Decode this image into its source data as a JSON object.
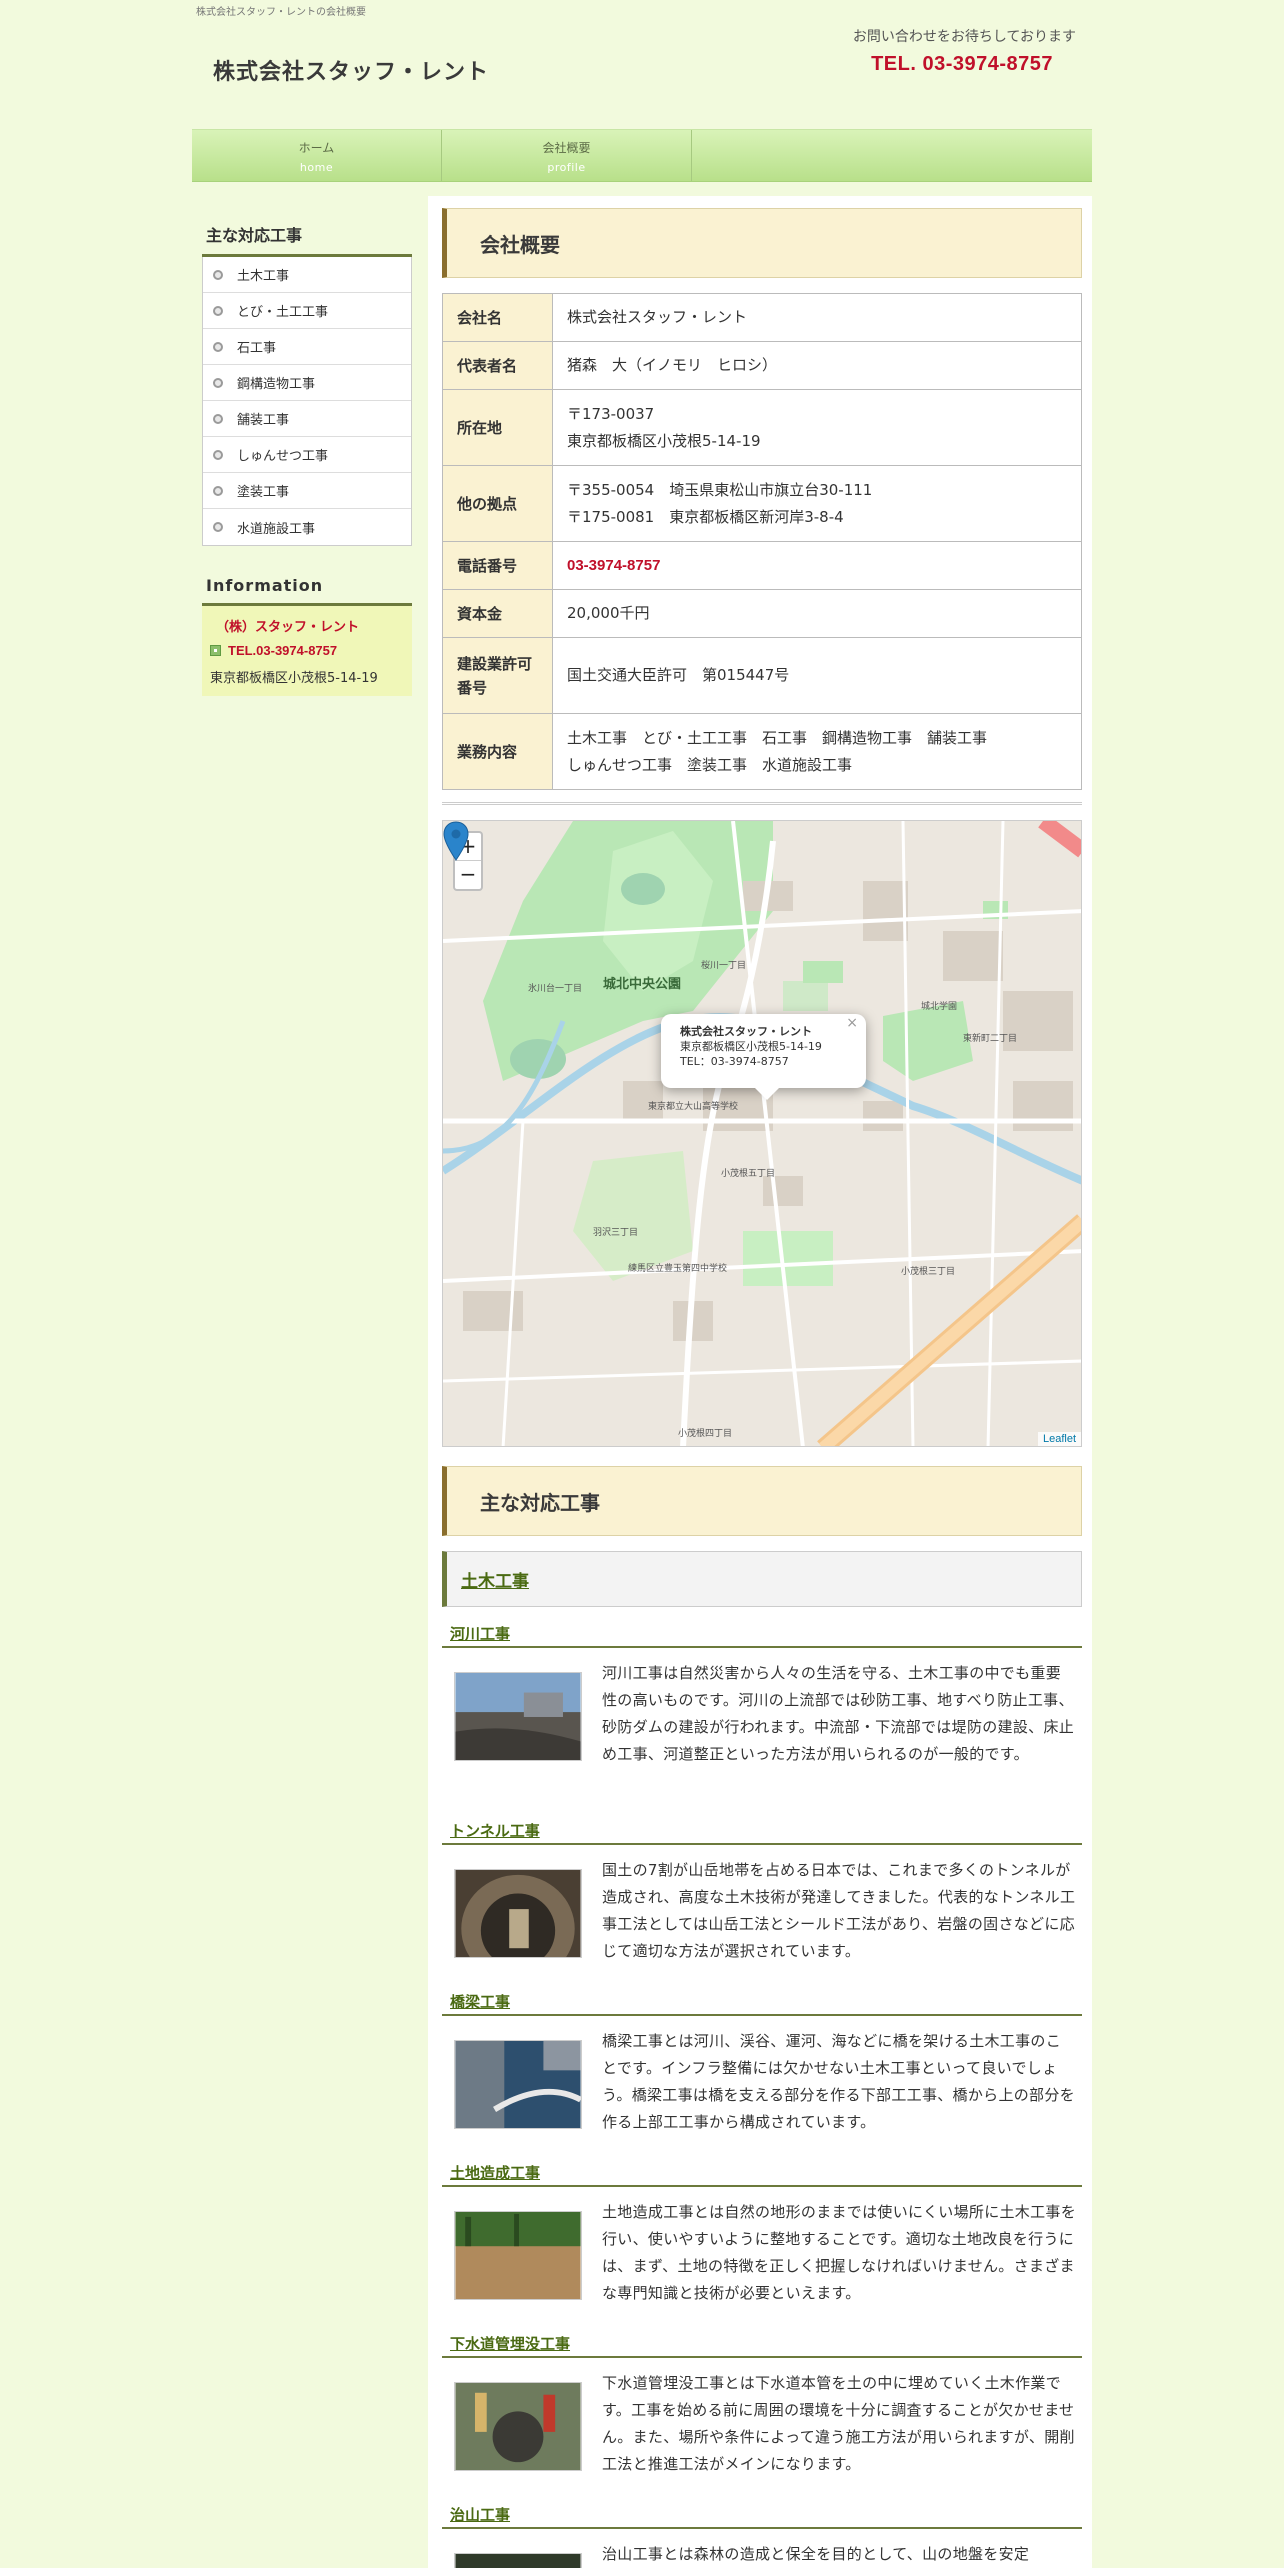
{
  "header": {
    "tagline": "株式会社スタッフ・レントの会社概要",
    "site_title": "株式会社スタッフ・レント",
    "contact_note": "お問い合わせをお待ちしております",
    "contact_tel": "TEL. 03-3974-8757"
  },
  "nav": [
    {
      "ja": "ホーム",
      "en": "home"
    },
    {
      "ja": "会社概要",
      "en": "profile"
    }
  ],
  "sidebar": {
    "heading": "主な対応工事",
    "items": [
      "土木工事",
      "とび・土工工事",
      "石工事",
      "鋼構造物工事",
      "舗装工事",
      "しゅんせつ工事",
      "塗装工事",
      "水道施設工事"
    ],
    "info_heading": "Information",
    "info_name": "（株）スタッフ・レント",
    "info_tel": "TEL.03-3974-8757",
    "info_address": "東京都板橋区小茂根5-14-19"
  },
  "main": {
    "profile_heading": "会社概要",
    "profile": [
      {
        "label": "会社名",
        "value": [
          "株式会社スタッフ・レント"
        ]
      },
      {
        "label": "代表者名",
        "value": [
          "猪森　大（イノモリ　ヒロシ）"
        ]
      },
      {
        "label": "所在地",
        "value": [
          "〒173-0037",
          "東京都板橋区小茂根5-14-19"
        ]
      },
      {
        "label": "他の拠点",
        "value": [
          "〒355-0054　埼玉県東松山市旗立台30-111",
          "〒175-0081　東京都板橋区新河岸3-8-4"
        ]
      },
      {
        "label": "電話番号",
        "value": [
          "03-3974-8757"
        ]
      },
      {
        "label": "資本金",
        "value": [
          "20,000千円"
        ]
      },
      {
        "label": "建設業許可番号",
        "value": [
          "国土交通大臣許可　第015447号"
        ]
      },
      {
        "label": "業務内容",
        "value": [
          "土木工事　とび・土工工事　石工事　鋼構造物工事　舗装工事",
          "しゅんせつ工事　塗装工事　水道施設工事"
        ]
      }
    ],
    "map": {
      "zoom_in": "+",
      "zoom_out": "−",
      "popup_title": "株式会社スタッフ・レント",
      "popup_address": "東京都板橋区小茂根5-14-19",
      "popup_tel": "TEL：03-3974-8757",
      "popup_close": "×",
      "attribution": "Leaflet",
      "labels": [
        "城北中央公園",
        "桜川一丁目",
        "氷川台一丁目",
        "小茂根五丁目",
        "羽沢三丁目",
        "小茂根三丁目",
        "小茂根四丁目",
        "東新町二丁目",
        "城北学園",
        "練馬区立豊玉第四中学校",
        "東京都立大山高等学校"
      ]
    },
    "works_heading": "主な対応工事",
    "category": "土木工事",
    "works": [
      {
        "title": "河川工事",
        "text": "河川工事は自然災害から人々の生活を守る、土木工事の中でも重要性の高いものです。河川の上流部では砂防工事、地すべり防止工事、砂防ダムの建設が行われます。中流部・下流部では堤防の建設、床止め工事、河道整正といった方法が用いられるのが一般的です。"
      },
      {
        "title": "トンネル工事",
        "text": "国土の7割が山岳地帯を占める日本では、これまで多くのトンネルが造成され、高度な土木技術が発達してきました。代表的なトンネル工事工法としては山岳工法とシールド工法があり、岩盤の固さなどに応じて適切な方法が選択されています。"
      },
      {
        "title": "橋梁工事",
        "text": "橋梁工事とは河川、渓谷、運河、海などに橋を架ける土木工事のことです。インフラ整備には欠かせない土木工事といって良いでしょう。橋梁工事は橋を支える部分を作る下部工工事、橋から上の部分を作る上部工工事から構成されています。"
      },
      {
        "title": "土地造成工事",
        "text": "土地造成工事とは自然の地形のままでは使いにくい場所に土木工事を行い、使いやすいように整地することです。適切な土地改良を行うには、まず、土地の特徴を正しく把握しなければいけません。さまざまな専門知識と技術が必要といえます。"
      },
      {
        "title": "下水道管埋没工事",
        "text": "下水道管埋没工事とは下水道本管を土の中に埋めていく土木作業です。工事を始める前に周囲の環境を十分に調査することが欠かせません。また、場所や条件によって違う施工方法が用いられますが、開削工法と推進工法がメインになります。"
      },
      {
        "title": "治山工事",
        "text": "治山工事とは森林の造成と保全を目的として、山の地盤を安定"
      }
    ]
  },
  "colors": {
    "background": "#f2fadd",
    "accent_red": "#c0102a",
    "nav_green": "#b8e08a",
    "heading_bg": "#faf2d2",
    "link_green": "#4a6a12"
  }
}
